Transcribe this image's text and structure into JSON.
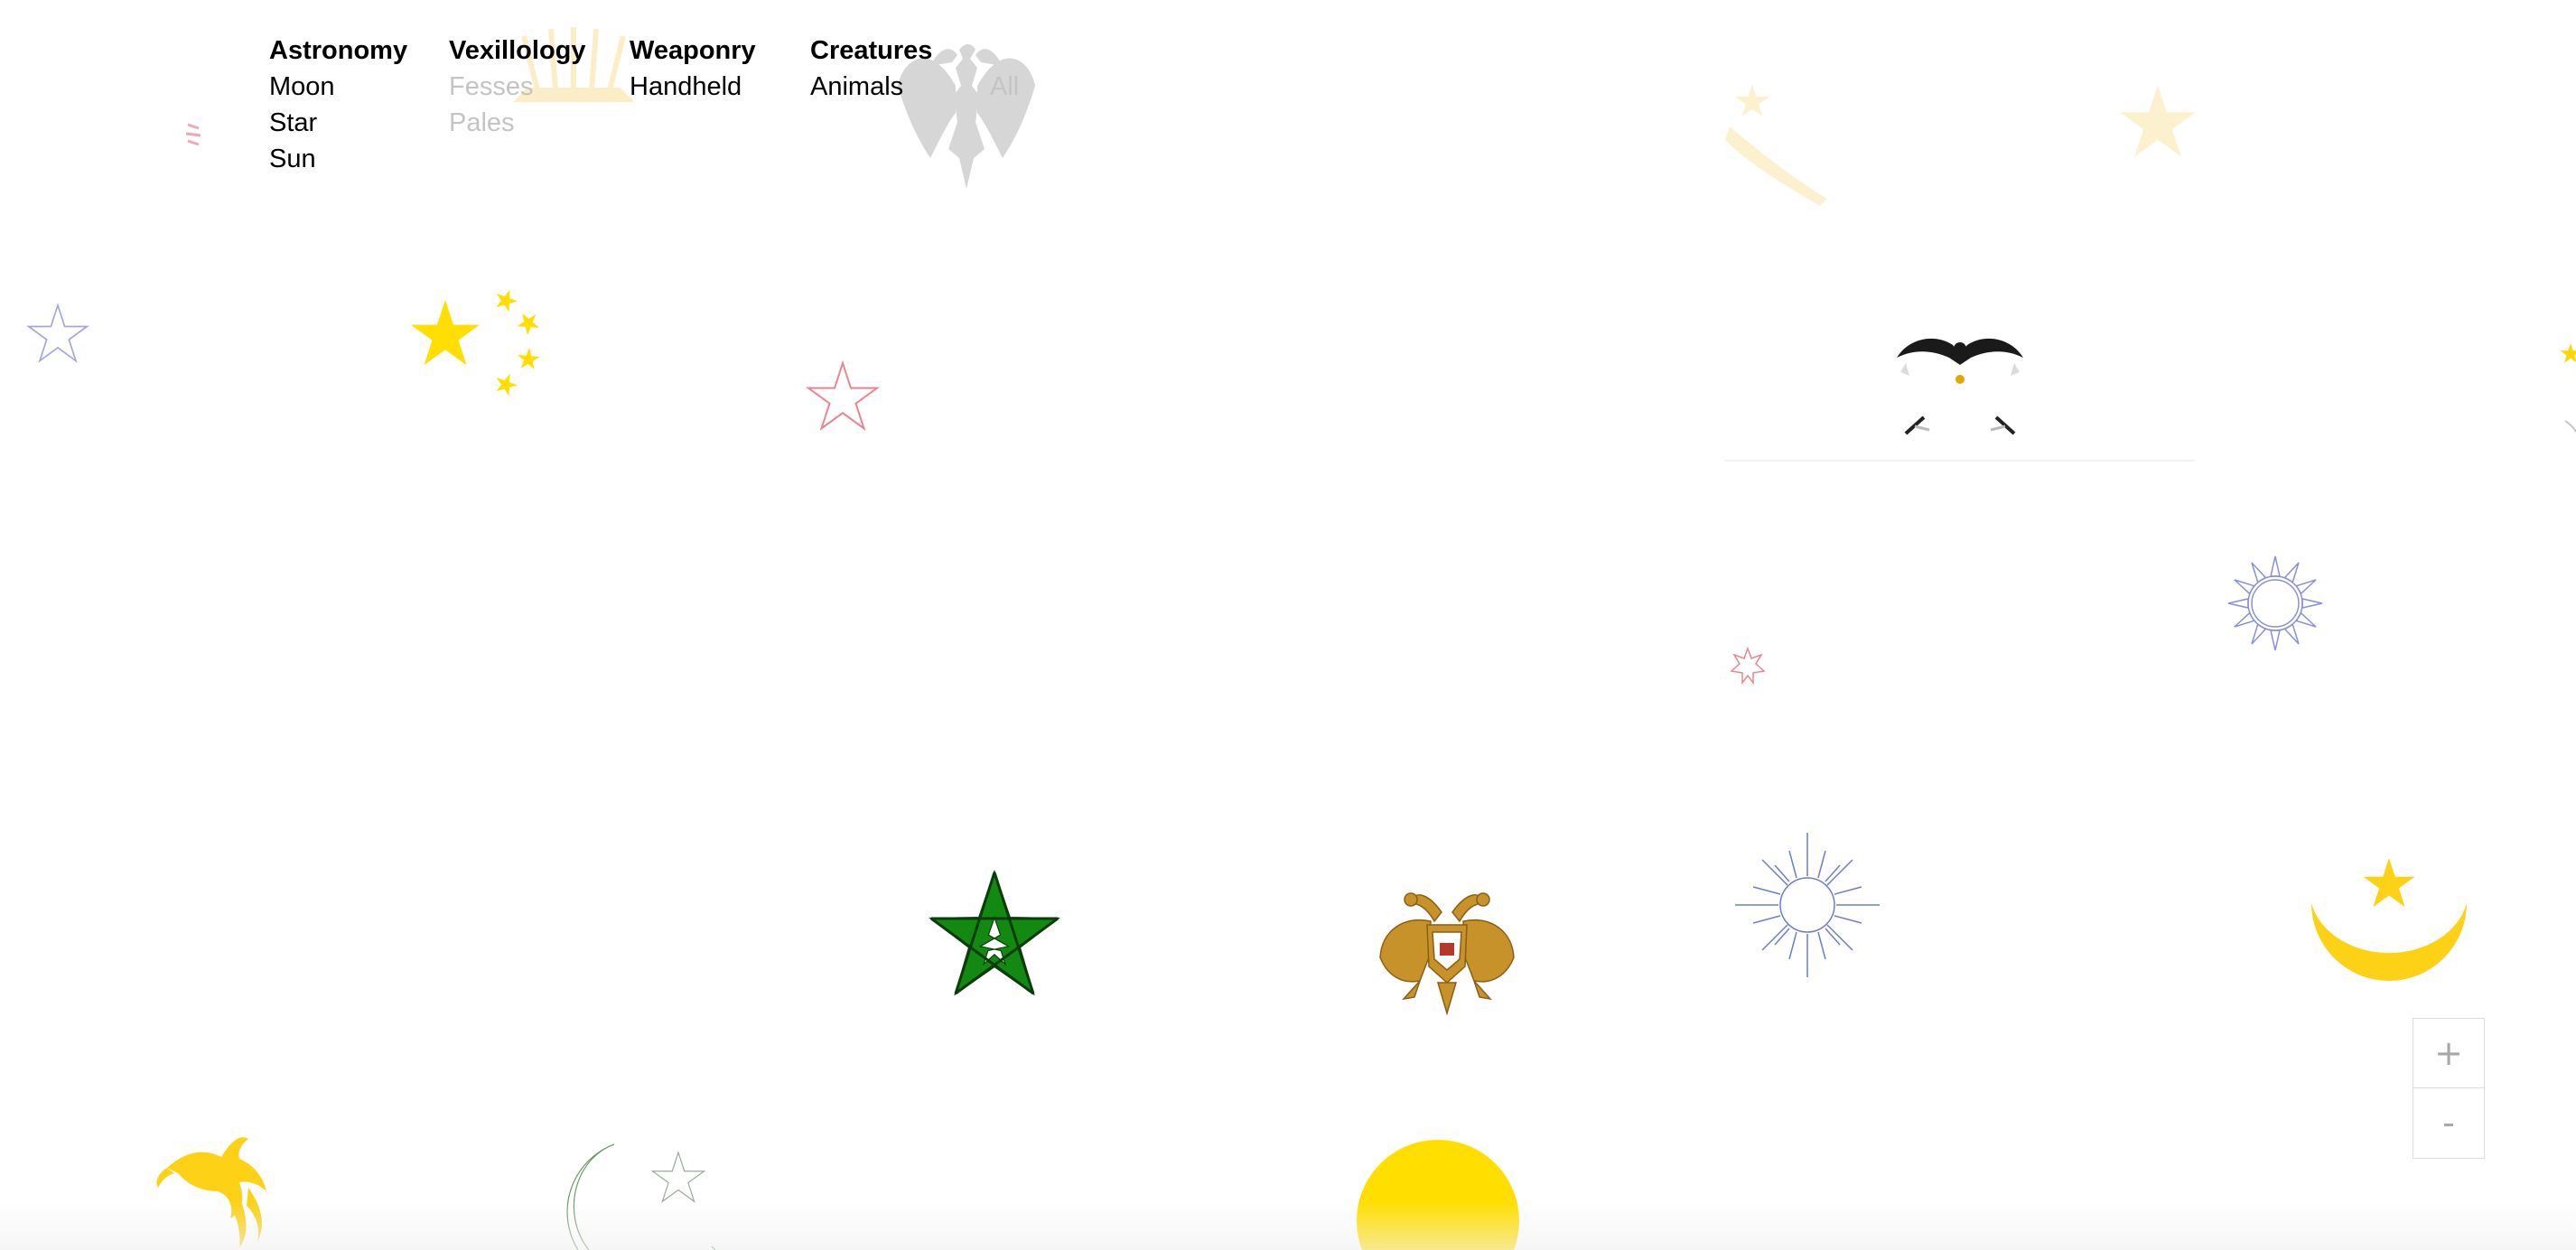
{
  "nav": {
    "groups": [
      {
        "heading": "Astronomy",
        "items": [
          {
            "label": "Moon",
            "muted": false
          },
          {
            "label": "Star",
            "muted": false
          },
          {
            "label": "Sun",
            "muted": false
          }
        ]
      },
      {
        "heading": "Vexillology",
        "items": [
          {
            "label": "Fesses",
            "muted": true
          },
          {
            "label": "Pales",
            "muted": true
          }
        ]
      },
      {
        "heading": "Weaponry",
        "items": [
          {
            "label": "Handheld",
            "muted": false
          }
        ]
      },
      {
        "heading": "Creatures",
        "items": [
          {
            "label": "Animals",
            "muted": false
          }
        ]
      }
    ],
    "all_label": "All"
  },
  "zoom": {
    "in_label": "+",
    "out_label": "-"
  },
  "colors": {
    "gold": "#ffd700",
    "yellow": "#fcd116",
    "green": "#128a12",
    "pale_blue": "#8a8fd8",
    "pink": "#e8858f",
    "eagle_gold": "#c8922a",
    "grey": "#cfcfcf",
    "pale_yellow": "#fbeec7",
    "black": "#1a1a1a"
  },
  "symbols": [
    {
      "name": "albanian-eagle-icon",
      "icon": "double-headed-eagle",
      "color": "#cfcfcf"
    },
    {
      "name": "sun-rays-icon",
      "icon": "sun-rays",
      "color": "#fbeec7"
    },
    {
      "name": "pink-marks-icon",
      "icon": "small-marks",
      "color": "#f2a6b0"
    },
    {
      "name": "chinese-stars-icon",
      "icon": "five-stars",
      "color": "#ffde00"
    },
    {
      "name": "outline-star-blue-icon",
      "icon": "star-outline",
      "color": "#8a8fd8"
    },
    {
      "name": "outline-star-pink-icon",
      "icon": "star-outline",
      "color": "#e8858f"
    },
    {
      "name": "faded-star-machete-icon",
      "icon": "star-and-machete",
      "color": "#fbeec7"
    },
    {
      "name": "faded-star-icon",
      "icon": "star",
      "color": "#fbeec7"
    },
    {
      "name": "black-eagle-icon",
      "icon": "eagle",
      "color": "#1a1a1a"
    },
    {
      "name": "partial-symbol-icon",
      "icon": "partial",
      "color": "#ffd700"
    },
    {
      "name": "blue-sun-outline-icon",
      "icon": "sun-outline",
      "color": "#8a8fd8"
    },
    {
      "name": "small-pink-star-icon",
      "icon": "seven-point-star",
      "color": "#e8858f"
    },
    {
      "name": "moroccan-pentagram-icon",
      "icon": "pentagram",
      "color": "#128a12"
    },
    {
      "name": "golden-eagle-icon",
      "icon": "double-headed-eagle",
      "color": "#c8922a"
    },
    {
      "name": "blue-starburst-icon",
      "icon": "starburst",
      "color": "#8a8fd8"
    },
    {
      "name": "crescent-star-icon",
      "icon": "crescent-and-star",
      "color": "#fcd116"
    },
    {
      "name": "bird-of-paradise-icon",
      "icon": "bird-of-paradise",
      "color": "#fcd116"
    },
    {
      "name": "outline-crescent-star-icon",
      "icon": "crescent-and-star-outline",
      "color": "#6b9b6b"
    },
    {
      "name": "yellow-disc-icon",
      "icon": "disc",
      "color": "#ffde00"
    }
  ]
}
